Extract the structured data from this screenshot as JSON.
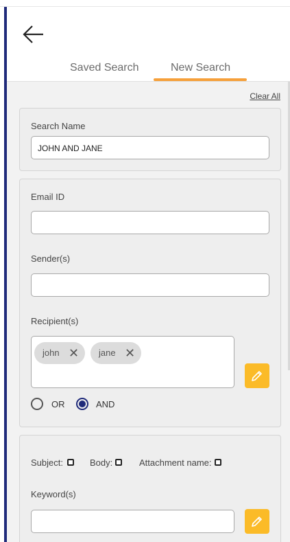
{
  "tabs": [
    {
      "label": "Saved Search",
      "active": false
    },
    {
      "label": "New Search",
      "active": true
    }
  ],
  "clear_all": "Clear All",
  "search_name": {
    "label": "Search Name",
    "value": "JOHN AND JANE"
  },
  "email_id": {
    "label": "Email ID",
    "value": ""
  },
  "senders": {
    "label": "Sender(s)",
    "value": ""
  },
  "recipients": {
    "label": "Recipient(s)",
    "chips": [
      {
        "label": "john"
      },
      {
        "label": "jane"
      }
    ],
    "logic": [
      {
        "label": "OR",
        "checked": false
      },
      {
        "label": "AND",
        "checked": true
      }
    ]
  },
  "search_in": [
    {
      "label": "Subject:",
      "checked": false
    },
    {
      "label": "Body:",
      "checked": false
    },
    {
      "label": "Attachment name:",
      "checked": false
    }
  ],
  "keywords": {
    "label": "Keyword(s)",
    "value": ""
  },
  "icons": {
    "back": "arrow-left-icon",
    "remove_chip": "close-icon",
    "edit": "pencil-icon"
  },
  "colors": {
    "accent": "#f6a03a",
    "edit_button": "#fbbb28",
    "radio_selected": "#1f2a7a",
    "side_bar": "#1f2a7a"
  }
}
